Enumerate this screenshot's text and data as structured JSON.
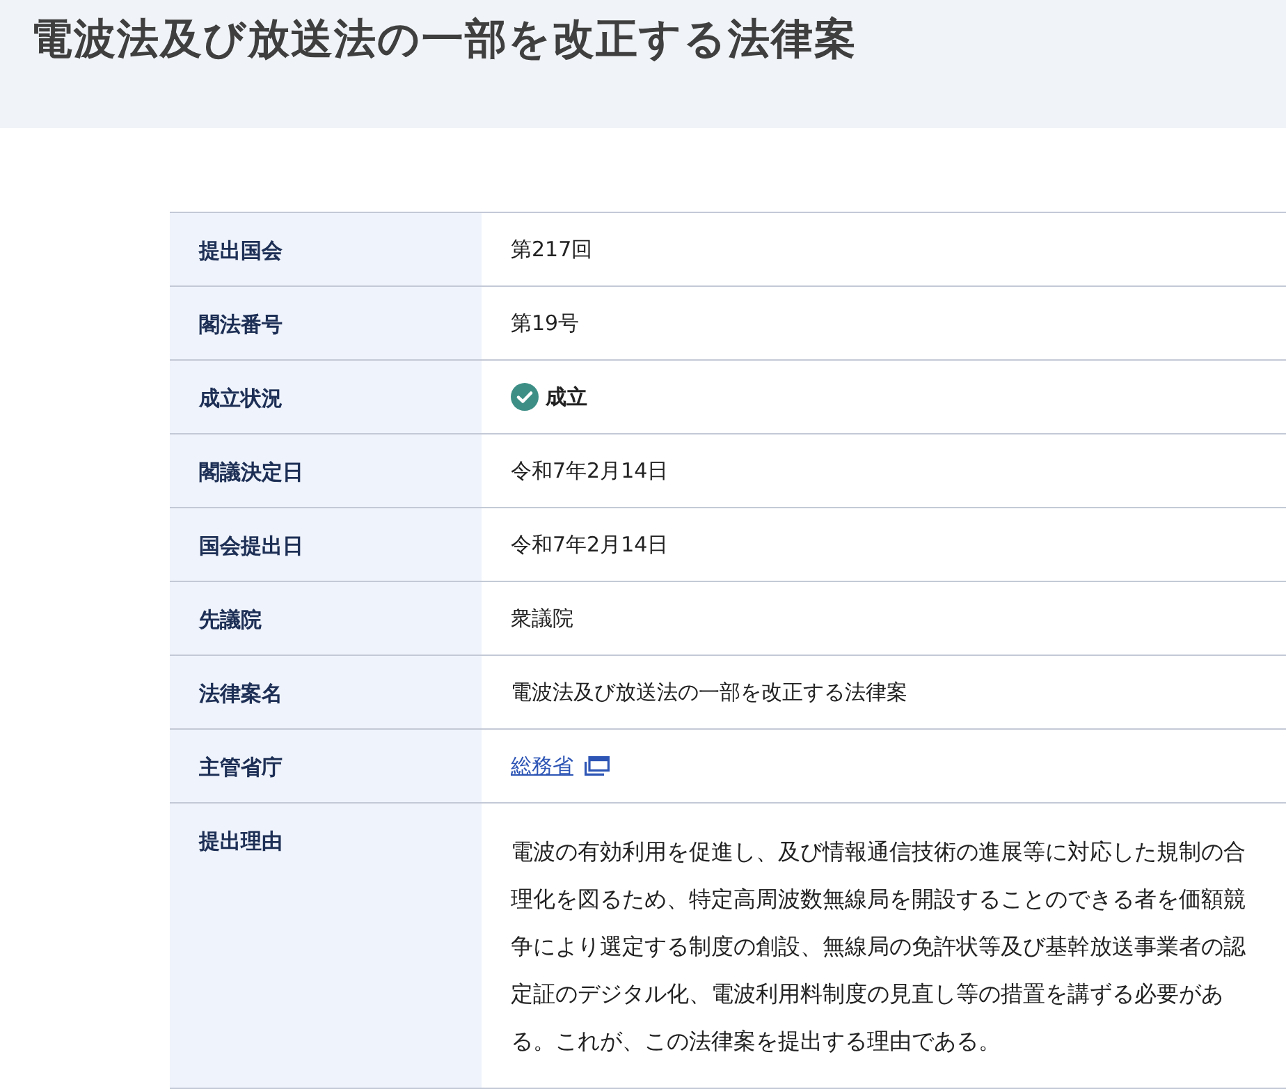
{
  "page_title": "電波法及び放送法の一部を改正する法律案",
  "details": [
    {
      "label": "提出国会",
      "kind": "text",
      "value": "第217回"
    },
    {
      "label": "閣法番号",
      "kind": "text",
      "value": "第19号"
    },
    {
      "label": "成立状況",
      "kind": "status",
      "value": "成立"
    },
    {
      "label": "閣議決定日",
      "kind": "text",
      "value": "令和7年2月14日"
    },
    {
      "label": "国会提出日",
      "kind": "text",
      "value": "令和7年2月14日"
    },
    {
      "label": "先議院",
      "kind": "text",
      "value": "衆議院"
    },
    {
      "label": "法律案名",
      "kind": "text",
      "value": "電波法及び放送法の一部を改正する法律案"
    },
    {
      "label": "主管省庁",
      "kind": "link",
      "value": "総務省"
    },
    {
      "label": "提出理由",
      "kind": "paragraph",
      "value": "電波の有効利用を促進し、及び情報通信技術の進展等に対応した規制の合理化を図るため、特定高周波数無線局を開設することのできる者を価額競争により選定する制度の創設、無線局の免許状等及び基幹放送事業者の認定証のデジタル化、電波利用料制度の見直し等の措置を講ずる必要がある。これが、この法律案を提出する理由である。"
    }
  ]
}
